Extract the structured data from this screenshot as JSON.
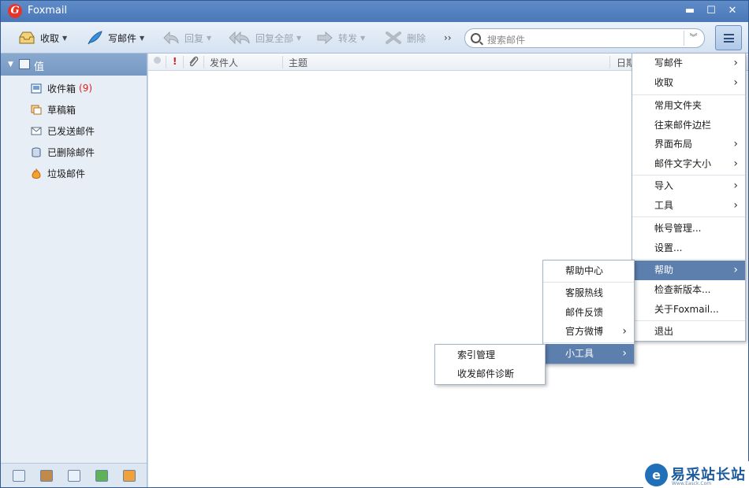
{
  "window": {
    "title": "Foxmail",
    "logo": "G"
  },
  "titlebar_buttons": {
    "minimize": "▬",
    "maximize": "☐",
    "close": "✕"
  },
  "toolbar": {
    "receive": "收取",
    "compose": "写邮件",
    "reply": "回复",
    "reply_all": "回复全部",
    "forward": "转发",
    "delete": "删除",
    "more": "››",
    "search_placeholder": "搜索邮件",
    "search_dropdown": "︾"
  },
  "account": {
    "name": "值"
  },
  "folders": [
    {
      "label": "收件箱",
      "count": "(9)",
      "icon": "inbox-icon"
    },
    {
      "label": "草稿箱",
      "count": "",
      "icon": "drafts-icon"
    },
    {
      "label": "已发送邮件",
      "count": "",
      "icon": "sent-icon"
    },
    {
      "label": "已删除邮件",
      "count": "",
      "icon": "trash-icon"
    },
    {
      "label": "垃圾邮件",
      "count": "",
      "icon": "junk-icon"
    }
  ],
  "columns": {
    "flag": "!",
    "sender": "发件人",
    "subject": "主题",
    "date": "日期"
  },
  "main_menu": [
    {
      "label": "写邮件",
      "submenu": true
    },
    {
      "label": "收取",
      "submenu": true
    },
    {
      "label": "常用文件夹",
      "submenu": false
    },
    {
      "label": "往来邮件边栏",
      "submenu": false
    },
    {
      "label": "界面布局",
      "submenu": true
    },
    {
      "label": "邮件文字大小",
      "submenu": true
    },
    {
      "label": "导入",
      "submenu": true
    },
    {
      "label": "工具",
      "submenu": true
    },
    {
      "label": "帐号管理...",
      "submenu": false
    },
    {
      "label": "设置...",
      "submenu": false
    },
    {
      "label": "帮助",
      "submenu": true,
      "highlighted": true
    },
    {
      "label": "检查新版本...",
      "submenu": false
    },
    {
      "label": "关于Foxmail...",
      "submenu": false
    },
    {
      "label": "退出",
      "submenu": false
    }
  ],
  "help_menu": [
    {
      "label": "帮助中心",
      "submenu": false
    },
    {
      "label": "客服热线",
      "submenu": false
    },
    {
      "label": "邮件反馈",
      "submenu": false
    },
    {
      "label": "官方微博",
      "submenu": true
    },
    {
      "label": "小工具",
      "submenu": true,
      "highlighted": true
    }
  ],
  "tools_menu": [
    {
      "label": "索引管理"
    },
    {
      "label": "收发邮件诊断"
    }
  ],
  "watermark": {
    "title": "易采站长站",
    "subtitle": "Www.Easck.Com"
  },
  "colors": {
    "titlebar": "#4a78b8",
    "highlight": "#5c7fae",
    "unread_count": "#e0201d"
  }
}
